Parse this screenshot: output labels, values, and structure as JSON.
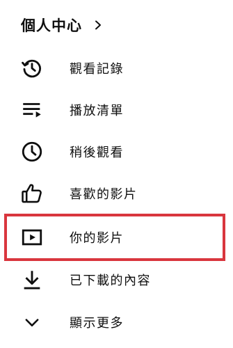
{
  "header": {
    "title": "個人中心",
    "chevron_icon": "chevron-right-icon"
  },
  "menu": {
    "items": [
      {
        "label": "觀看記錄",
        "icon": "history-icon"
      },
      {
        "label": "播放清單",
        "icon": "playlist-icon"
      },
      {
        "label": "稍後觀看",
        "icon": "clock-icon"
      },
      {
        "label": "喜歡的影片",
        "icon": "thumbs-up-icon"
      },
      {
        "label": "你的影片",
        "icon": "your-videos-icon"
      },
      {
        "label": "已下載的內容",
        "icon": "download-icon"
      },
      {
        "label": "顯示更多",
        "icon": "chevron-down-icon"
      }
    ]
  },
  "colors": {
    "text": "#0f0f0f",
    "highlight_border": "#d9363e",
    "background": "#ffffff"
  }
}
